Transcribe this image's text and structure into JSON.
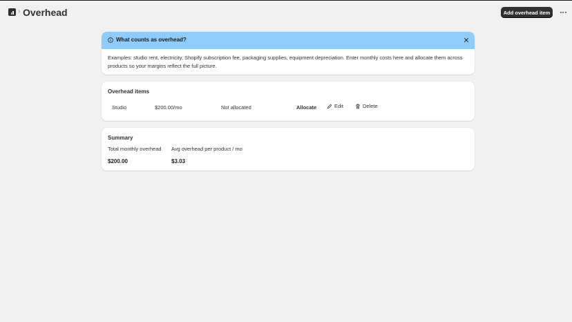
{
  "header": {
    "title": "Overhead",
    "breadcrumb_separator": "›",
    "add_button_label": "Add overhead item",
    "app_icon": "bar-chart-icon",
    "more_icon": "ellipsis-icon"
  },
  "banner": {
    "title": "What counts as overhead?",
    "body": "Examples: studio rent, electricity, Shopify subscription fee, packaging supplies, equipment depreciation. Enter monthly costs here and allocate them across products so your margins reflect the full picture.",
    "background_color": "#90ccfb",
    "icon": "info-icon",
    "close_icon": "close-icon"
  },
  "items": {
    "title": "Overhead items",
    "rows": [
      {
        "name": "Studio",
        "amount": "$200.00/mo",
        "allocation_status": "Not allocated",
        "allocate_label": "Allocate",
        "edit_label": "Edit",
        "delete_label": "Delete"
      }
    ]
  },
  "summary": {
    "title": "Summary",
    "total_label": "Total monthly overhead",
    "total_value": "$200.00",
    "avg_label": "Avg overhead per product / mo",
    "avg_value": "$3.03"
  }
}
